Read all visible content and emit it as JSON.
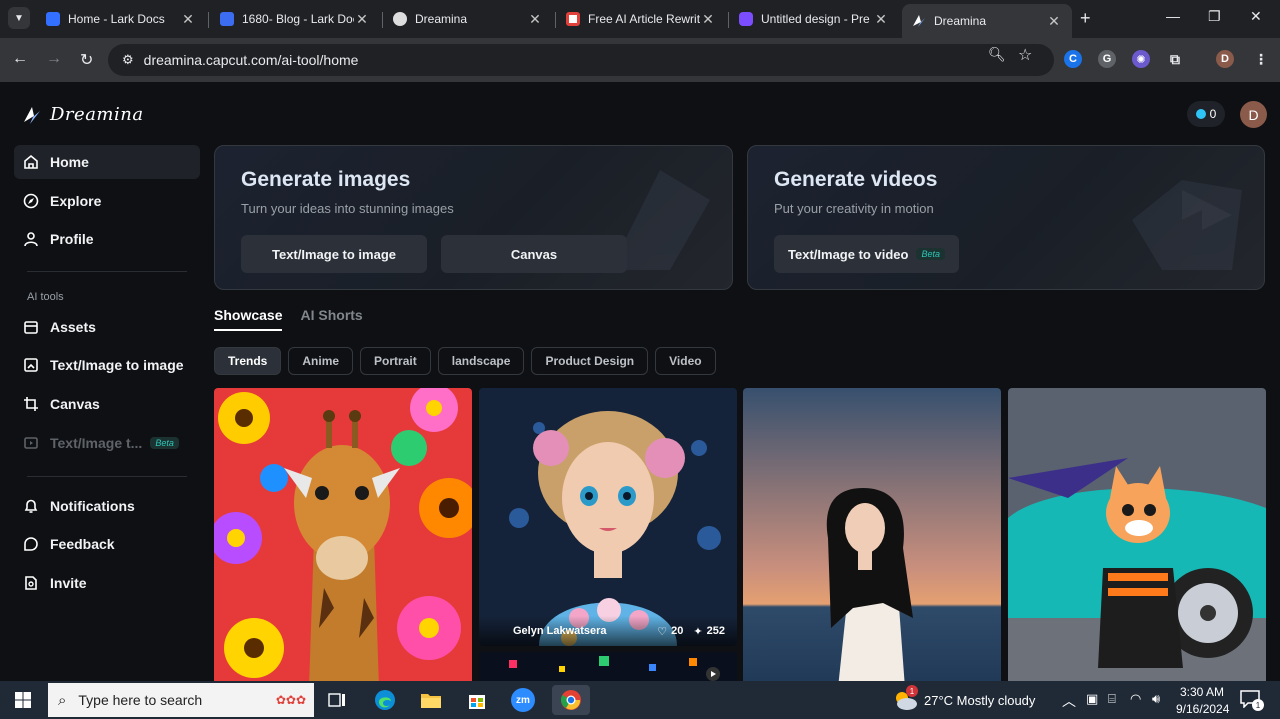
{
  "browser": {
    "tabs": [
      {
        "title": "Home - Lark Docs",
        "favicon": "lark-icon",
        "color": "#3370ff"
      },
      {
        "title": "1680- Blog - Lark Doc",
        "favicon": "doc-icon",
        "color": "#3c6df0"
      },
      {
        "title": "Dreamina",
        "favicon": "dreamina-icon",
        "color": "#dddddd"
      },
      {
        "title": "Free AI Article Rewrit",
        "favicon": "rewrite-icon",
        "color": "#e0413a"
      },
      {
        "title": "Untitled design - Pre",
        "favicon": "canva-icon",
        "color": "#7c4dff"
      },
      {
        "title": "Dreamina",
        "favicon": "dreamina-icon",
        "color": "#ffffff"
      }
    ],
    "active_tab": 5,
    "url": "dreamina.capcut.com/ai-tool/home"
  },
  "app": {
    "brand": "Dreamina",
    "credits": "0",
    "user_initial": "D",
    "nav": {
      "home": "Home",
      "explore": "Explore",
      "profile": "Profile",
      "ai_tools_heading": "AI tools",
      "assets": "Assets",
      "text_image_to_image": "Text/Image to image",
      "canvas": "Canvas",
      "text_image_to_video": "Text/Image t...",
      "beta": "Beta",
      "notifications": "Notifications",
      "feedback": "Feedback",
      "invite": "Invite"
    },
    "images_card": {
      "title": "Generate images",
      "subtitle": "Turn your ideas into stunning images",
      "btn1": "Text/Image to image",
      "btn2": "Canvas"
    },
    "videos_card": {
      "title": "Generate videos",
      "subtitle": "Put your creativity in motion",
      "btn1": "Text/Image to video",
      "beta": "Beta"
    },
    "section_tabs": [
      "Showcase",
      "AI Shorts"
    ],
    "chips": [
      "Trends",
      "Anime",
      "Portrait",
      "landscape",
      "Product Design",
      "Video"
    ],
    "gallery": [
      {
        "subject": "giraffe with flowers"
      },
      {
        "subject": "doll with flowers",
        "author": "Gelyn Lakwatsera",
        "likes": "20",
        "uses": "252"
      },
      {
        "subject": "woman at beach sunset"
      },
      {
        "subject": "cat character with sports car"
      }
    ]
  },
  "taskbar": {
    "search_placeholder": "Type here to search",
    "weather": "27°C  Mostly cloudy",
    "weather_badge": "1",
    "time": "3:30 AM",
    "date": "9/16/2024",
    "notif_count": "1"
  },
  "colors": {
    "accent": "#2ec4b6",
    "bg": "#0e1014",
    "card_border": "#34393f"
  }
}
